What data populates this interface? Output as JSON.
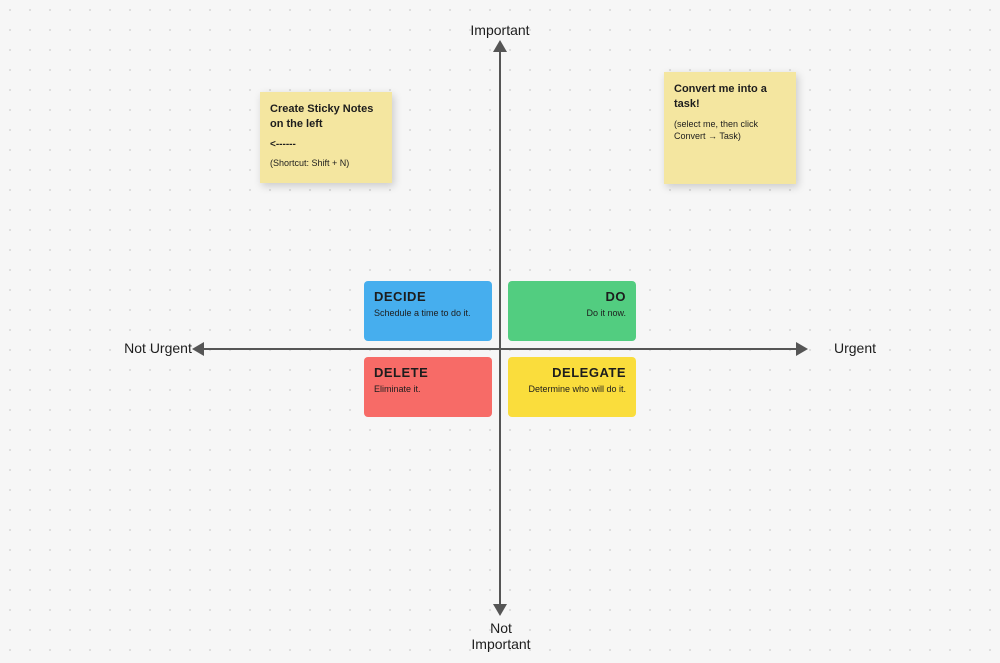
{
  "axes": {
    "top": "Important",
    "bottom": "Not Important",
    "right": "Urgent",
    "left": "Not Urgent"
  },
  "quadrants": {
    "decide": {
      "title": "DECIDE",
      "sub": "Schedule a time to do it."
    },
    "do": {
      "title": "DO",
      "sub": "Do it now."
    },
    "delete": {
      "title": "DELETE",
      "sub": "Eliminate it."
    },
    "delegate": {
      "title": "DELEGATE",
      "sub": "Determine who will do it."
    }
  },
  "stickies": {
    "s1": {
      "line1": "Create Sticky Notes on the left",
      "arrow": "<------",
      "hint": "(Shortcut: Shift + N)"
    },
    "s2": {
      "line1": "Convert me into a task!",
      "hint": "(select me, then click Convert → Task)"
    }
  }
}
